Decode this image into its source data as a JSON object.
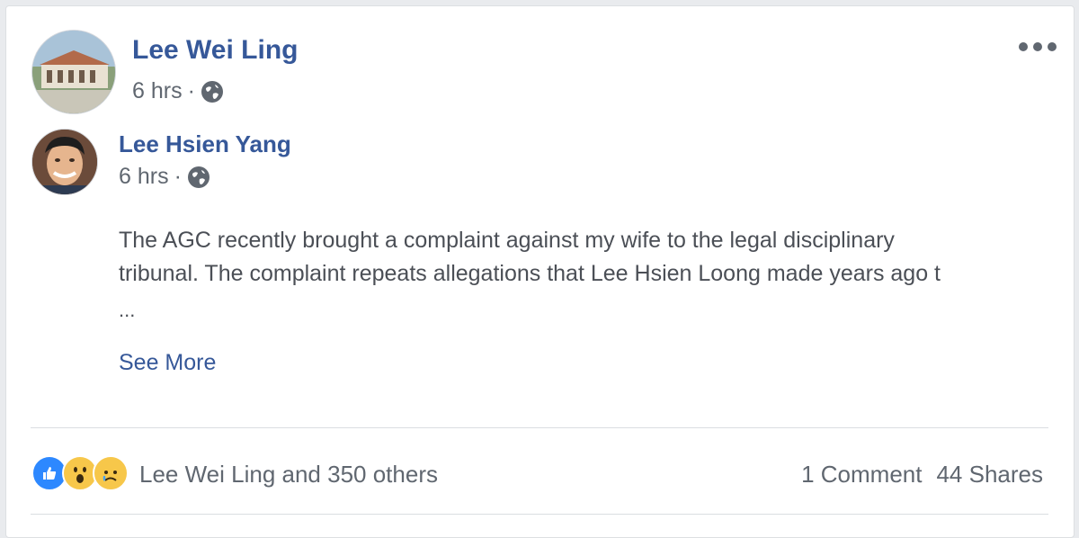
{
  "post": {
    "author": "Lee Wei Ling",
    "time": "6 hrs",
    "meta_sep": "·",
    "privacy_icon": "globe-icon",
    "more_icon": "ellipsis-icon"
  },
  "shared": {
    "author": "Lee Hsien Yang",
    "time": "6 hrs",
    "meta_sep": "·",
    "privacy_icon": "globe-icon",
    "text_line1": "The AGC recently brought a complaint against my wife to the legal disciplinary",
    "text_line2": "tribunal. The complaint repeats allegations that Lee Hsien Loong made years ago t",
    "ellipsis": "...",
    "see_more": "See More"
  },
  "footer": {
    "reaction_icons": [
      "like-icon",
      "wow-icon",
      "sad-icon"
    ],
    "reactions_text": "Lee Wei Ling and 350 others",
    "comments": "1 Comment",
    "shares": "44 Shares"
  },
  "colors": {
    "link": "#365899",
    "meta": "#606770",
    "text": "#4b4f56",
    "like": "#2d88ff",
    "emoji": "#f7c74a"
  }
}
